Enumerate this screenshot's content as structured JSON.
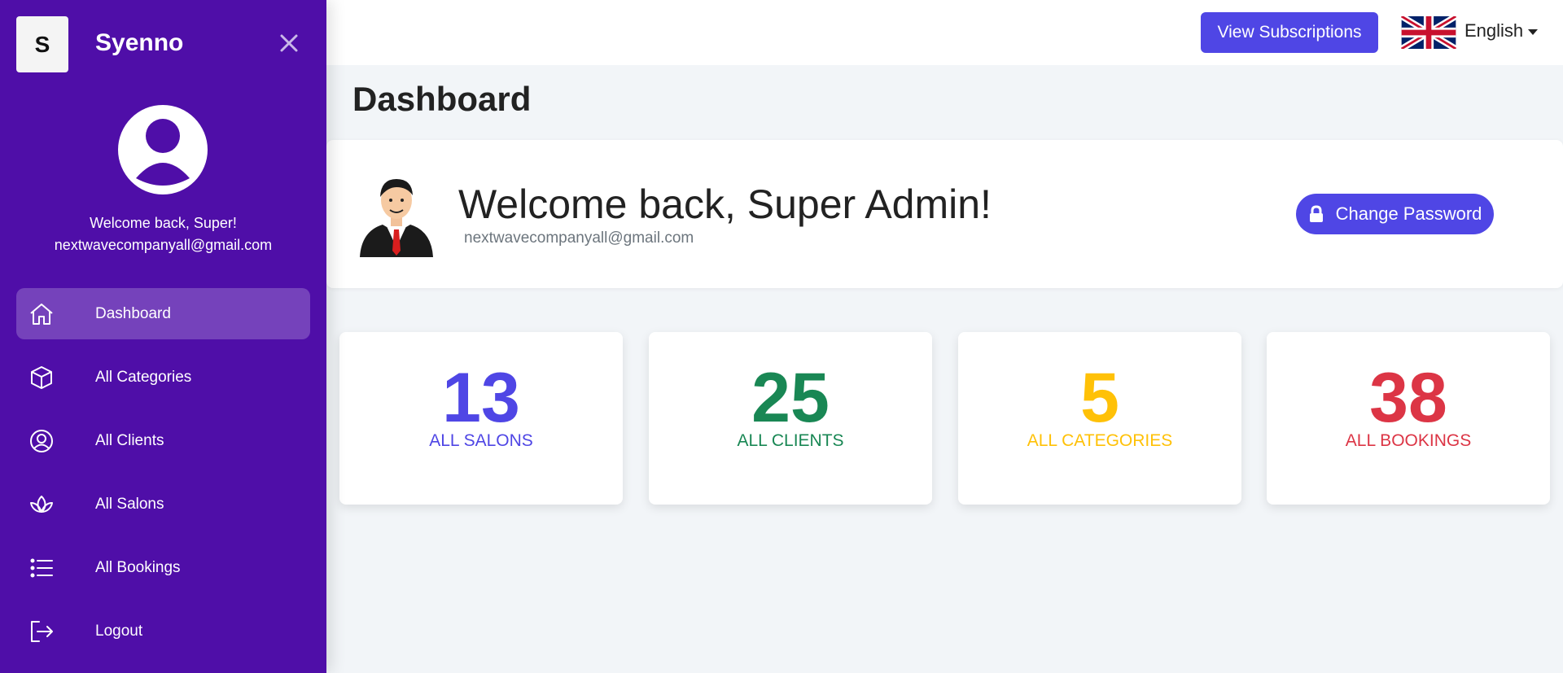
{
  "sidebar": {
    "brand_letter": "S",
    "brand_name": "Syenno",
    "welcome": "Welcome back, Super!",
    "email": "nextwavecompanyall@gmail.com",
    "items": [
      {
        "label": "Dashboard",
        "icon": "home-icon",
        "active": true
      },
      {
        "label": "All Categories",
        "icon": "cube-icon"
      },
      {
        "label": "All Clients",
        "icon": "user-circle-icon"
      },
      {
        "label": "All Salons",
        "icon": "lotus-icon"
      },
      {
        "label": "All Bookings",
        "icon": "list-icon"
      },
      {
        "label": "Logout",
        "icon": "logout-icon"
      }
    ]
  },
  "topbar": {
    "subscriptions_label": "View Subscriptions",
    "language": "English",
    "flag_icon": "uk-flag-icon"
  },
  "page": {
    "title": "Dashboard"
  },
  "welcome_card": {
    "title": "Welcome back, Super Admin!",
    "email": "nextwavecompanyall@gmail.com",
    "change_password_label": "Change Password"
  },
  "stats": [
    {
      "value": "13",
      "label": "ALL SALONS",
      "color": "#4f46e5"
    },
    {
      "value": "25",
      "label": "ALL CLIENTS",
      "color": "#198754"
    },
    {
      "value": "5",
      "label": "ALL CATEGORIES",
      "color": "#ffc107"
    },
    {
      "value": "38",
      "label": "ALL BOOKINGS",
      "color": "#dc3545"
    }
  ],
  "colors": {
    "sidebar_bg": "#4f0ea8",
    "accent": "#4f46e5",
    "page_bg": "#f2f5f8"
  }
}
